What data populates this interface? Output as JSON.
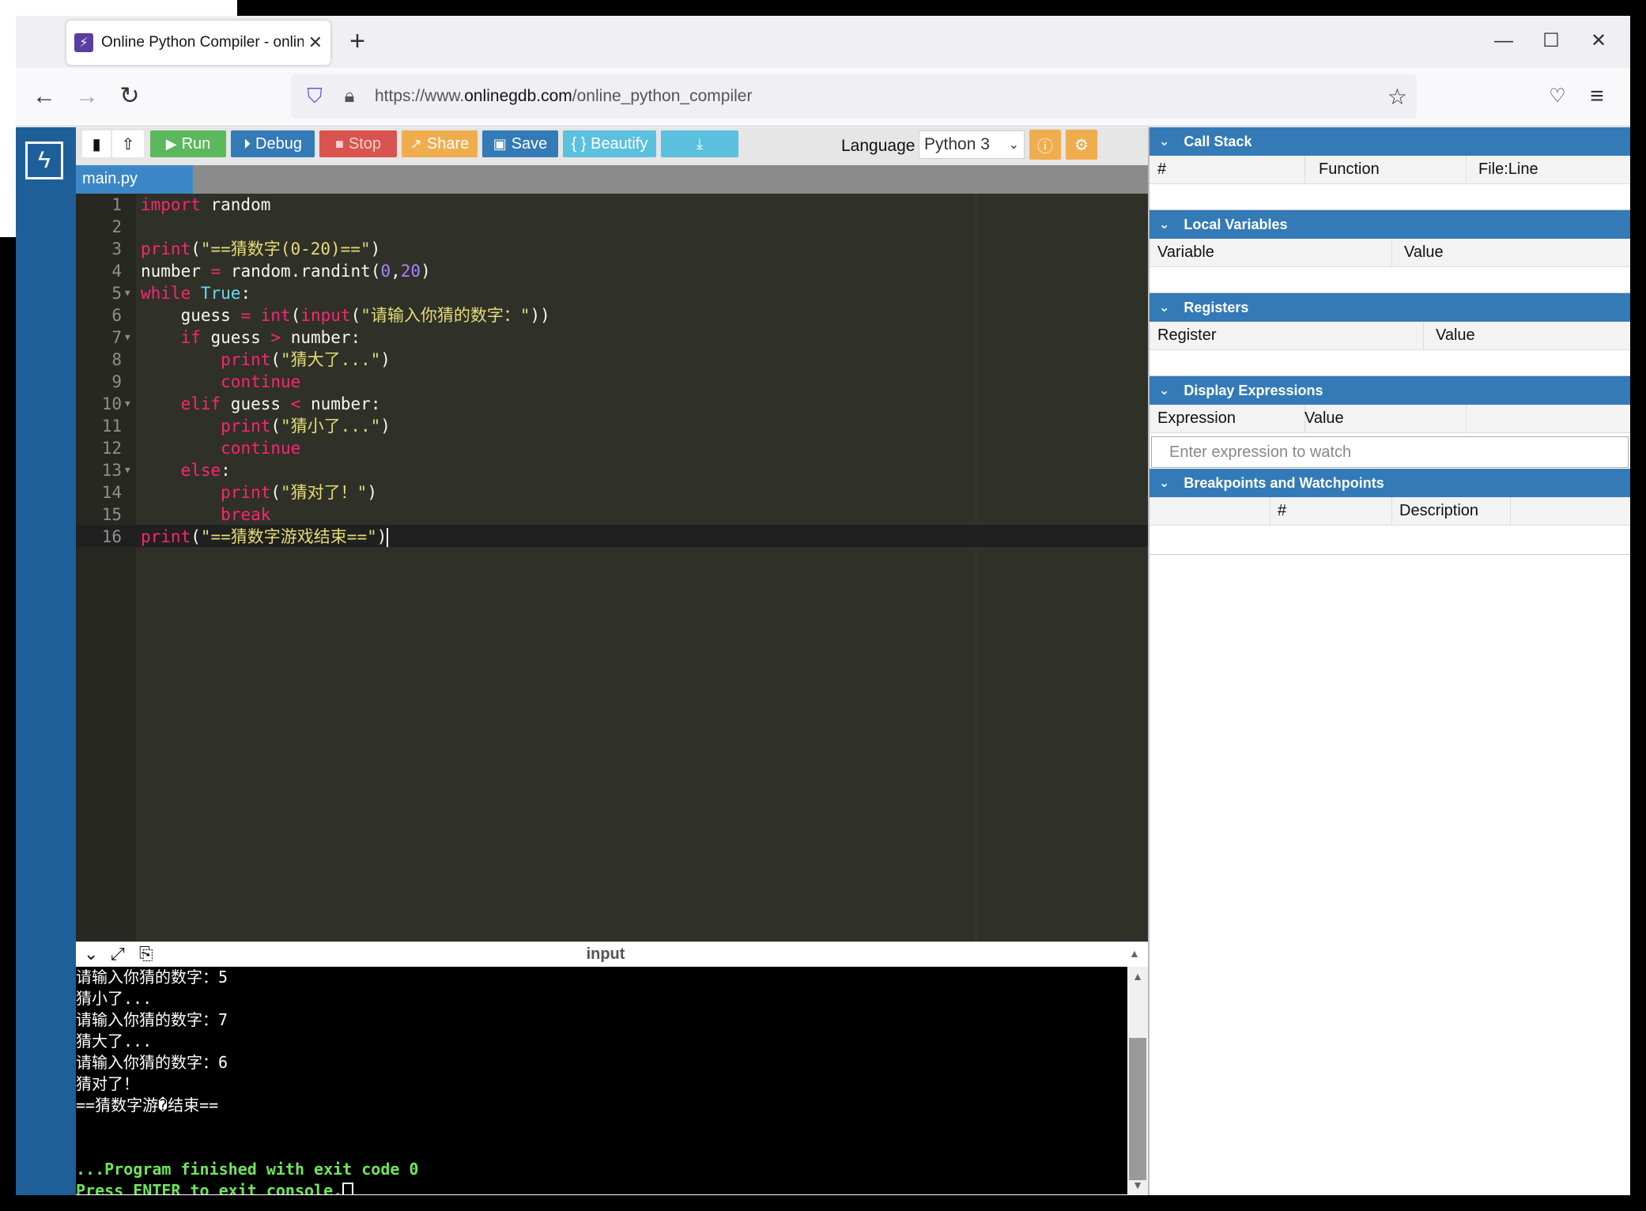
{
  "browser": {
    "tab_title": "Online Python Compiler - online editor",
    "url_prefix": "https://www.",
    "url_domain": "onlinegdb.com",
    "url_path": "/online_python_compiler"
  },
  "toolbar": {
    "run_label": "Run",
    "debug_label": "Debug",
    "stop_label": "Stop",
    "share_label": "Share",
    "save_label": "Save",
    "beautify_label": "{ } Beautify",
    "language_label": "Language",
    "language_value": "Python 3"
  },
  "file_tab": "main.py",
  "editor": {
    "line_numbers": [
      "1",
      "2",
      "3",
      "4",
      "5",
      "6",
      "7",
      "8",
      "9",
      "10",
      "11",
      "12",
      "13",
      "14",
      "15",
      "16"
    ]
  },
  "output": {
    "title": "input",
    "lines": [
      "请输入你猜的数字：5",
      "猜小了...",
      "请输入你猜的数字：7",
      "猜大了...",
      "请输入你猜的数字：6",
      "猜对了！",
      "==猜数字游�结束=="
    ],
    "finished": "...Program finished with exit code 0",
    "press_enter": "Press ENTER to exit console."
  },
  "debug": {
    "call_stack": {
      "title": "Call Stack",
      "cols": [
        "#",
        "Function",
        "File:Line"
      ]
    },
    "local_variables": {
      "title": "Local Variables",
      "cols": [
        "Variable",
        "Value"
      ]
    },
    "registers": {
      "title": "Registers",
      "cols": [
        "Register",
        "Value"
      ]
    },
    "display_expressions": {
      "title": "Display Expressions",
      "cols": [
        "Expression",
        "Value"
      ],
      "placeholder": "Enter expression to watch"
    },
    "breakpoints": {
      "title": "Breakpoints and Watchpoints",
      "cols": [
        "#",
        "Description"
      ]
    }
  },
  "colors": {
    "rail": "#1e5f99",
    "panel_header": "#337ab7",
    "run": "#5cb85c",
    "debug": "#337ab7",
    "stop": "#d9534f",
    "share": "#f0ad4e",
    "save": "#337ab7",
    "beautify": "#5bc0de",
    "download": "#5bc0de",
    "editor_bg": "#2f3129"
  }
}
